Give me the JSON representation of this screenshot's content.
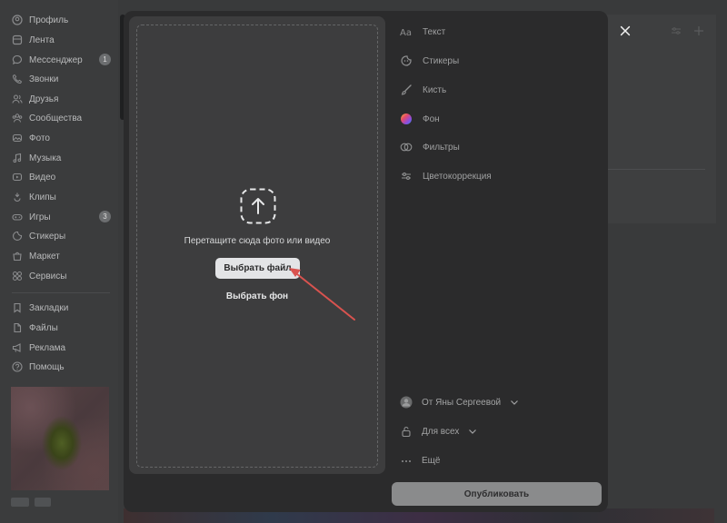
{
  "sidebar": {
    "items": [
      {
        "label": "Профиль",
        "icon": "user-circle-icon"
      },
      {
        "label": "Лента",
        "icon": "newsfeed-icon"
      },
      {
        "label": "Мессенджер",
        "icon": "message-icon",
        "badge": "1"
      },
      {
        "label": "Звонки",
        "icon": "phone-icon"
      },
      {
        "label": "Друзья",
        "icon": "friends-icon"
      },
      {
        "label": "Сообщества",
        "icon": "communities-icon"
      },
      {
        "label": "Фото",
        "icon": "photo-icon"
      },
      {
        "label": "Музыка",
        "icon": "music-icon"
      },
      {
        "label": "Видео",
        "icon": "video-icon"
      },
      {
        "label": "Клипы",
        "icon": "clips-icon"
      },
      {
        "label": "Игры",
        "icon": "games-icon",
        "badge": "3"
      },
      {
        "label": "Стикеры",
        "icon": "stickers-icon"
      },
      {
        "label": "Маркет",
        "icon": "market-icon"
      },
      {
        "label": "Сервисы",
        "icon": "services-icon"
      }
    ],
    "secondary_items": [
      {
        "label": "Закладки",
        "icon": "bookmark-icon"
      },
      {
        "label": "Файлы",
        "icon": "file-icon"
      },
      {
        "label": "Реклама",
        "icon": "megaphone-icon"
      },
      {
        "label": "Помощь",
        "icon": "help-icon"
      }
    ]
  },
  "editor": {
    "upload": {
      "drop_text": "Перетащите сюда фото или видео",
      "choose_file_label": "Выбрать файл",
      "choose_background_label": "Выбрать фон",
      "icon": "upload-arrow-icon"
    },
    "tools": [
      {
        "label": "Текст",
        "icon": "text-aa-icon"
      },
      {
        "label": "Стикеры",
        "icon": "sticker-icon"
      },
      {
        "label": "Кисть",
        "icon": "brush-icon"
      },
      {
        "label": "Фон",
        "icon": "color-wheel-icon"
      },
      {
        "label": "Фильтры",
        "icon": "filters-icon"
      },
      {
        "label": "Цветокоррекция",
        "icon": "adjust-sliders-icon"
      }
    ],
    "author_label": "От Яны Сергеевой",
    "privacy_label": "Для всех",
    "more_label": "Ещё",
    "publish_label": "Опубликовать"
  },
  "colors": {
    "modal_bg": "#2b2b2c",
    "upload_bg": "#3d3d3e",
    "primary_button_bg": "#e3e4e6",
    "publish_button_bg": "#8a8b8c",
    "annotation_arrow": "#d9534f"
  }
}
